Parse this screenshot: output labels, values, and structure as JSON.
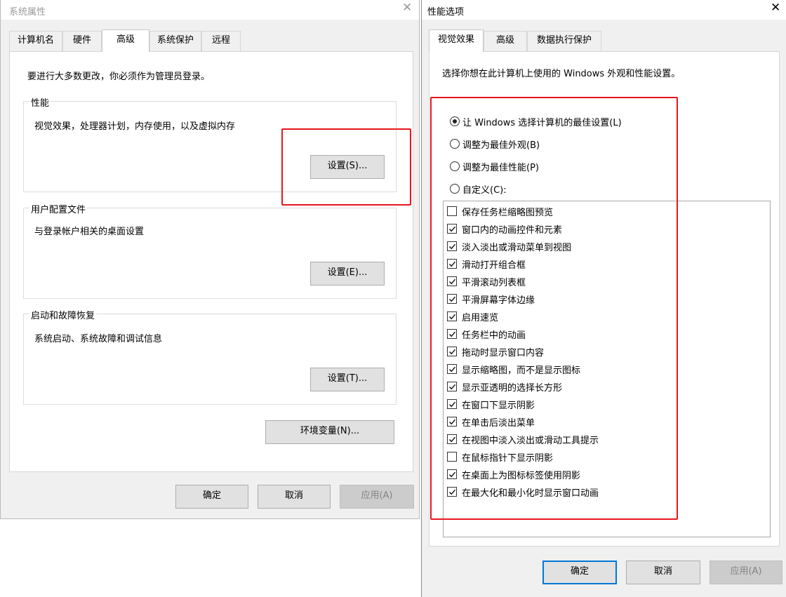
{
  "system_properties": {
    "title": "系统属性",
    "tabs": [
      "计算机名",
      "硬件",
      "高级",
      "系统保护",
      "远程"
    ],
    "active_tab": "高级",
    "admin_note": "要进行大多数更改，你必须作为管理员登录。",
    "performance": {
      "title": "性能",
      "desc": "视觉效果，处理器计划，内存使用，以及虚拟内存",
      "button": "设置(S)..."
    },
    "user_profiles": {
      "title": "用户配置文件",
      "desc": "与登录帐户相关的桌面设置",
      "button": "设置(E)..."
    },
    "startup_recovery": {
      "title": "启动和故障恢复",
      "desc": "系统启动、系统故障和调试信息",
      "button": "设置(T)..."
    },
    "env_button": "环境变量(N)...",
    "ok": "确定",
    "cancel": "取消",
    "apply": "应用(A)"
  },
  "performance_options": {
    "title": "性能选项",
    "tabs": [
      "视觉效果",
      "高级",
      "数据执行保护"
    ],
    "active_tab": "视觉效果",
    "intro": "选择你想在此计算机上使用的 Windows 外观和性能设置。",
    "radios": [
      {
        "label": "让 Windows 选择计算机的最佳设置(L)",
        "checked": true
      },
      {
        "label": "调整为最佳外观(B)",
        "checked": false
      },
      {
        "label": "调整为最佳性能(P)",
        "checked": false
      },
      {
        "label": "自定义(C):",
        "checked": false
      }
    ],
    "options": [
      {
        "label": "保存任务栏缩略图预览",
        "checked": false
      },
      {
        "label": "窗口内的动画控件和元素",
        "checked": true
      },
      {
        "label": "淡入淡出或滑动菜单到视图",
        "checked": true
      },
      {
        "label": "滑动打开组合框",
        "checked": true
      },
      {
        "label": "平滑滚动列表框",
        "checked": true
      },
      {
        "label": "平滑屏幕字体边缘",
        "checked": true
      },
      {
        "label": "启用速览",
        "checked": true
      },
      {
        "label": "任务栏中的动画",
        "checked": true
      },
      {
        "label": "拖动时显示窗口内容",
        "checked": true
      },
      {
        "label": "显示缩略图，而不是显示图标",
        "checked": true
      },
      {
        "label": "显示亚透明的选择长方形",
        "checked": true
      },
      {
        "label": "在窗口下显示阴影",
        "checked": true
      },
      {
        "label": "在单击后淡出菜单",
        "checked": true
      },
      {
        "label": "在视图中淡入淡出或滑动工具提示",
        "checked": true
      },
      {
        "label": "在鼠标指针下显示阴影",
        "checked": false
      },
      {
        "label": "在桌面上为图标标签使用阴影",
        "checked": true
      },
      {
        "label": "在最大化和最小化时显示窗口动画",
        "checked": true
      }
    ],
    "ok": "确定",
    "cancel": "取消",
    "apply": "应用(A)"
  },
  "colors": {
    "highlight_red": "#e8161e",
    "default_button_blue": "#0078d7",
    "dialog_bg": "#f0f0f0"
  }
}
